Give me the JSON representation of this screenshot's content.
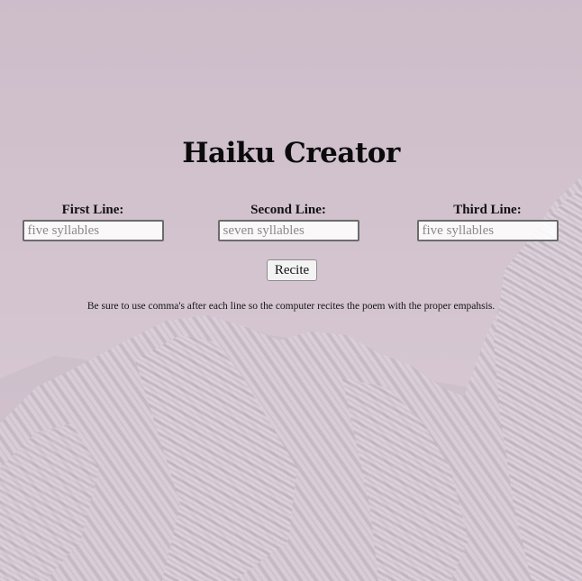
{
  "page": {
    "title": "Haiku Creator",
    "fields": [
      {
        "label": "First Line:",
        "placeholder": "five syllables",
        "value": ""
      },
      {
        "label": "Second Line:",
        "placeholder": "seven syllables",
        "value": ""
      },
      {
        "label": "Third Line:",
        "placeholder": "five syllables",
        "value": ""
      }
    ],
    "recite_label": "Recite",
    "note": "Be sure to use comma's after each line so the computer recites the poem with the proper empahsis."
  },
  "colors": {
    "sky": "#cbbcc8",
    "overlay": "#d6c6d2",
    "rock": "#8f8893",
    "snow": "#e9e3ea"
  }
}
